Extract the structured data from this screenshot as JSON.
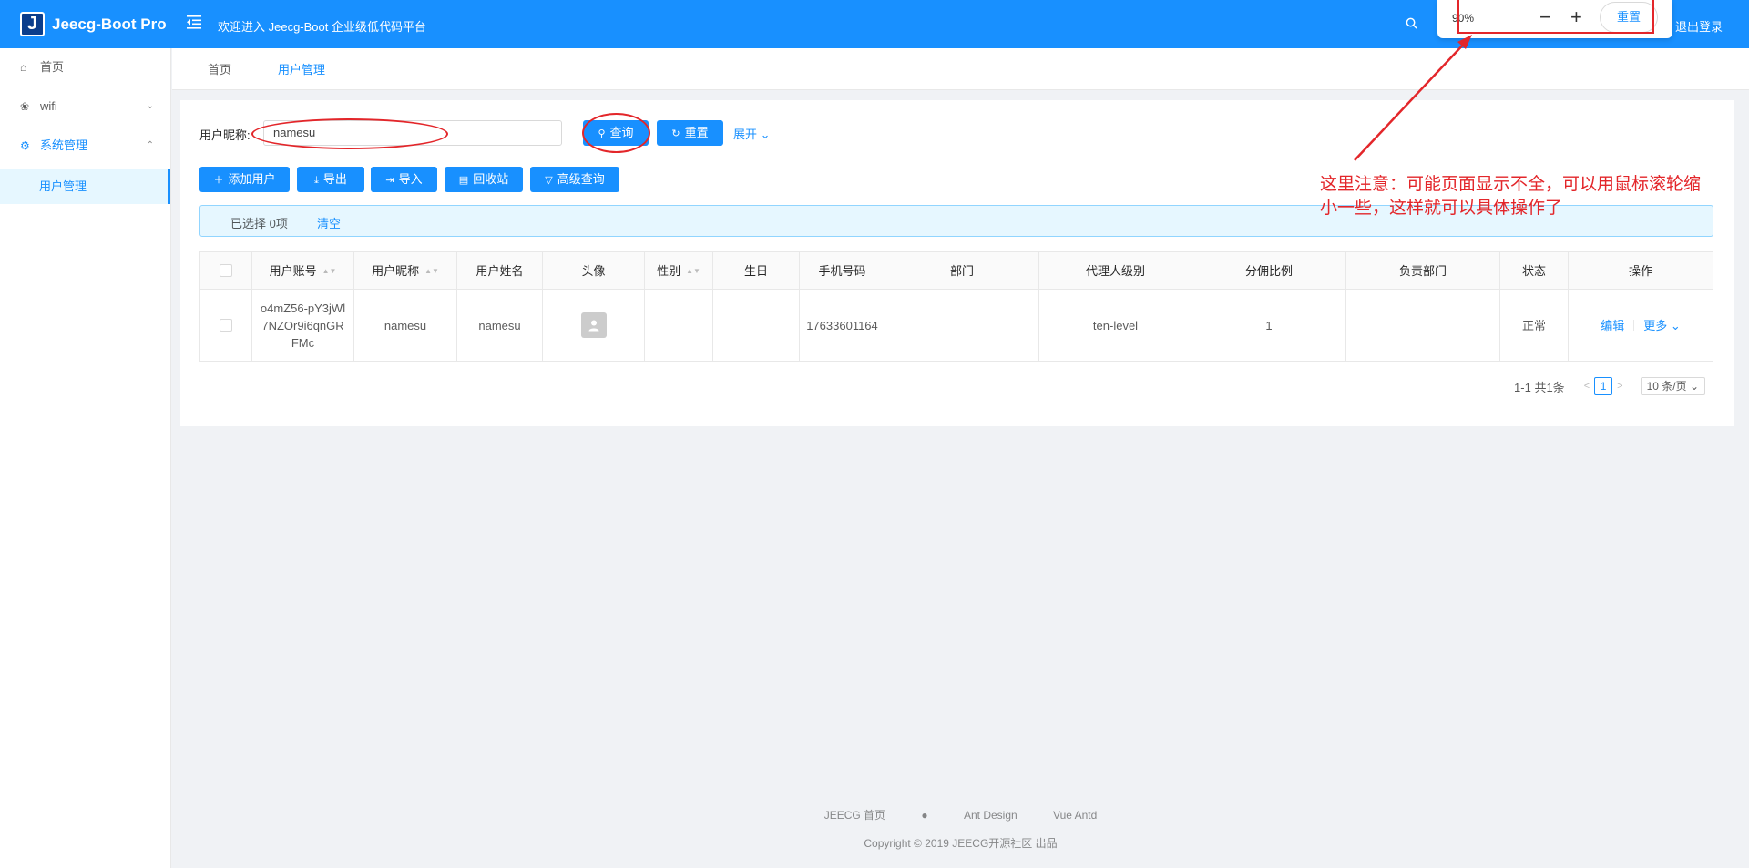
{
  "header": {
    "logo_letter": "J",
    "brand": "Jeecg-Boot Pro",
    "welcome": "欢迎进入 Jeecg-Boot 企业级低代码平台",
    "logout": "退出登录"
  },
  "zoom_popup": {
    "value": "90%",
    "minus": "−",
    "plus": "+",
    "reset": "重置"
  },
  "sidebar": {
    "items": [
      {
        "label": "首页",
        "icon": "home-icon"
      },
      {
        "label": "wifi",
        "icon": "wifi-icon"
      },
      {
        "label": "系统管理",
        "icon": "gear-icon"
      },
      {
        "label": "用户管理"
      }
    ]
  },
  "tabs": [
    {
      "label": "首页"
    },
    {
      "label": "用户管理"
    }
  ],
  "query": {
    "label": "用户昵称:",
    "value": "namesu",
    "search_btn": "查询",
    "reset_btn": "重置",
    "expand": "展开"
  },
  "toolbar": {
    "add": "添加用户",
    "export": "导出",
    "import": "导入",
    "recycle": "回收站",
    "advanced": "高级查询"
  },
  "selection": {
    "text": "已选择 0项",
    "clear": "清空"
  },
  "table": {
    "headers": {
      "account": "用户账号",
      "nickname": "用户昵称",
      "realname": "用户姓名",
      "avatar": "头像",
      "gender": "性别",
      "birthday": "生日",
      "phone": "手机号码",
      "dept": "部门",
      "agent_level": "代理人级别",
      "commission": "分佣比例",
      "leader_dept": "负责部门",
      "status": "状态",
      "action": "操作"
    },
    "rows": [
      {
        "account": "o4mZ56-pY3jWl7NZOr9i6qnGRFMc",
        "nickname": "namesu",
        "realname": "namesu",
        "gender": "",
        "birthday": "",
        "phone": "17633601164",
        "dept": "",
        "agent_level": "ten-level",
        "commission": "1",
        "leader_dept": "",
        "status": "正常",
        "edit": "编辑",
        "more": "更多"
      }
    ]
  },
  "pagination": {
    "total": "1-1 共1条",
    "current": "1",
    "page_size": "10 条/页"
  },
  "footer": {
    "link_home": "JEECG 首页",
    "link_ant": "Ant Design",
    "link_vue": "Vue Antd",
    "copyright": "Copyright © 2019 JEECG开源社区 出品"
  },
  "annotation": {
    "text": "这里注意：可能页面显示不全，可以用鼠标滚轮缩小一些，这样就可以具体操作了",
    "color": "#e3262a"
  },
  "colors": {
    "primary": "#1890ff",
    "annotation": "#e3262a"
  }
}
